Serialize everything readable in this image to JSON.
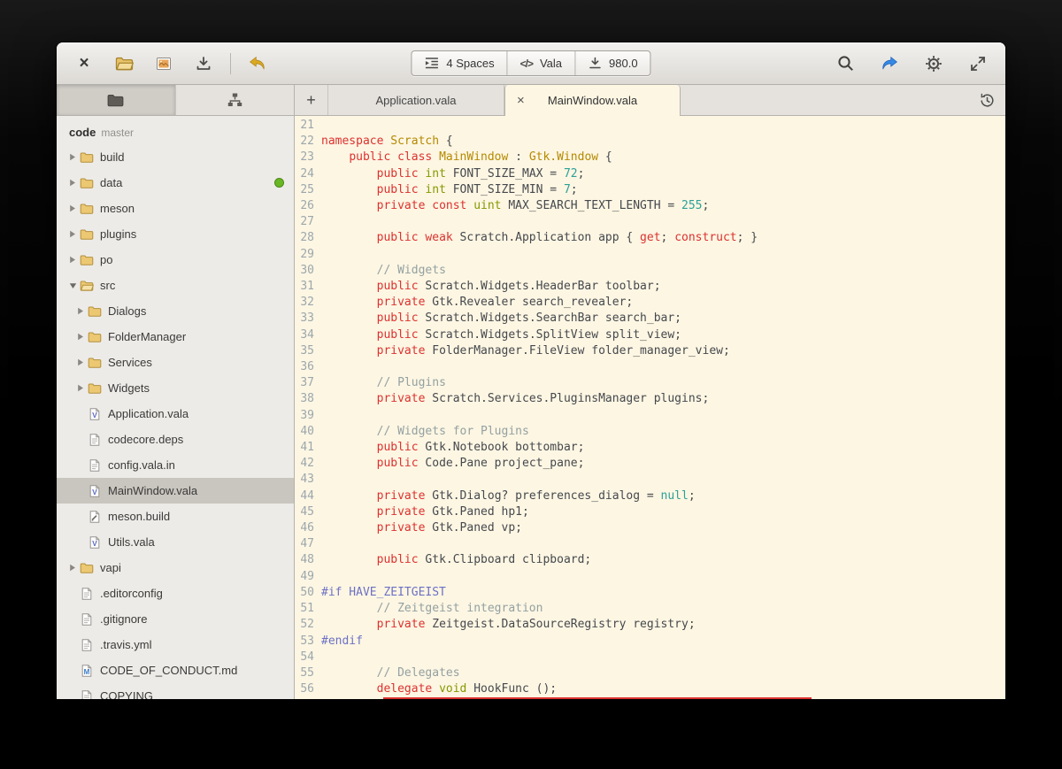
{
  "colors": {
    "green_dot": "#68b723",
    "accent_blue": "#3689e6",
    "undo_amber": "#dba821"
  },
  "headerbar": {
    "buttons_left": [
      {
        "name": "close-window",
        "icon": "close"
      },
      {
        "name": "open-file",
        "icon": "open-folder"
      },
      {
        "name": "templates",
        "icon": "templates"
      },
      {
        "name": "save",
        "icon": "save"
      },
      {
        "type": "separator"
      },
      {
        "name": "undo",
        "icon": "undo"
      }
    ],
    "buttons_center": [
      {
        "name": "indentation",
        "icon": "indent",
        "label": "4 Spaces"
      },
      {
        "name": "language",
        "icon": "code-tag",
        "label": "Vala"
      },
      {
        "name": "goto-line",
        "icon": "goto-line",
        "label": "980.0"
      }
    ],
    "buttons_right": [
      {
        "name": "search",
        "icon": "search"
      },
      {
        "name": "share",
        "icon": "share"
      },
      {
        "name": "settings",
        "icon": "gear"
      },
      {
        "name": "fullscreen",
        "icon": "expand"
      }
    ]
  },
  "sidebar": {
    "project_name": "code",
    "project_branch": "master",
    "panel_tabs": [
      {
        "name": "files-view",
        "icon": "files-folder",
        "active": true
      },
      {
        "name": "outline-view",
        "icon": "outline",
        "active": false
      }
    ],
    "items": [
      {
        "label": "build",
        "icon": "folder",
        "depth": 0,
        "arrow": "collapsed"
      },
      {
        "label": "data",
        "icon": "folder",
        "depth": 0,
        "arrow": "collapsed",
        "badge": "green-dot"
      },
      {
        "label": "meson",
        "icon": "folder",
        "depth": 0,
        "arrow": "collapsed"
      },
      {
        "label": "plugins",
        "icon": "folder",
        "depth": 0,
        "arrow": "collapsed"
      },
      {
        "label": "po",
        "icon": "folder",
        "depth": 0,
        "arrow": "collapsed"
      },
      {
        "label": "src",
        "icon": "folder-open",
        "depth": 0,
        "arrow": "expanded"
      },
      {
        "label": "Dialogs",
        "icon": "folder",
        "depth": 1,
        "arrow": "collapsed"
      },
      {
        "label": "FolderManager",
        "icon": "folder",
        "depth": 1,
        "arrow": "collapsed"
      },
      {
        "label": "Services",
        "icon": "folder",
        "depth": 1,
        "arrow": "collapsed"
      },
      {
        "label": "Widgets",
        "icon": "folder",
        "depth": 1,
        "arrow": "collapsed"
      },
      {
        "label": "Application.vala",
        "icon": "file-vala",
        "depth": 1
      },
      {
        "label": "codecore.deps",
        "icon": "file-text",
        "depth": 1
      },
      {
        "label": "config.vala.in",
        "icon": "file-text",
        "depth": 1
      },
      {
        "label": "MainWindow.vala",
        "icon": "file-vala",
        "depth": 1,
        "selected": true
      },
      {
        "label": "meson.build",
        "icon": "file-build",
        "depth": 1
      },
      {
        "label": "Utils.vala",
        "icon": "file-vala",
        "depth": 1
      },
      {
        "label": "vapi",
        "icon": "folder",
        "depth": 0,
        "arrow": "collapsed"
      },
      {
        "label": ".editorconfig",
        "icon": "file-text",
        "depth": 0
      },
      {
        "label": ".gitignore",
        "icon": "file-text",
        "depth": 0
      },
      {
        "label": ".travis.yml",
        "icon": "file-text",
        "depth": 0
      },
      {
        "label": "CODE_OF_CONDUCT.md",
        "icon": "file-md",
        "depth": 0
      },
      {
        "label": "COPYING",
        "icon": "file-text",
        "depth": 0
      }
    ]
  },
  "tabbar": {
    "new_tab_icon": "plus",
    "history_icon": "history",
    "tabs": [
      {
        "label": "Application.vala",
        "active": false
      },
      {
        "label": "MainWindow.vala",
        "active": true,
        "closable": true
      }
    ]
  },
  "editor": {
    "first_line": 21,
    "clipped_next_line_marker": true,
    "token_colors": {
      "keyword": "#dc322f",
      "class": "#b58900",
      "type": "#859900",
      "number": "#2aa198",
      "comment": "#93a1a1",
      "preprocessor": "#6c71c4",
      "plain": "#45484d",
      "line_number": "#9ca7ac",
      "background": "#fdf6e3"
    },
    "lines": [
      [],
      [
        [
          "k",
          "namespace"
        ],
        [
          "p",
          " "
        ],
        [
          "y",
          "Scratch"
        ],
        [
          "p",
          " {"
        ]
      ],
      [
        [
          "p",
          "    "
        ],
        [
          "k",
          "public class"
        ],
        [
          "p",
          " "
        ],
        [
          "y",
          "MainWindow"
        ],
        [
          "p",
          " : "
        ],
        [
          "y",
          "Gtk.Window"
        ],
        [
          "p",
          " {"
        ]
      ],
      [
        [
          "p",
          "        "
        ],
        [
          "k",
          "public"
        ],
        [
          "p",
          " "
        ],
        [
          "t",
          "int"
        ],
        [
          "p",
          " FONT_SIZE_MAX = "
        ],
        [
          "n",
          "72"
        ],
        [
          "p",
          ";"
        ]
      ],
      [
        [
          "p",
          "        "
        ],
        [
          "k",
          "public"
        ],
        [
          "p",
          " "
        ],
        [
          "t",
          "int"
        ],
        [
          "p",
          " FONT_SIZE_MIN = "
        ],
        [
          "n",
          "7"
        ],
        [
          "p",
          ";"
        ]
      ],
      [
        [
          "p",
          "        "
        ],
        [
          "k",
          "private const"
        ],
        [
          "p",
          " "
        ],
        [
          "t",
          "uint"
        ],
        [
          "p",
          " MAX_SEARCH_TEXT_LENGTH = "
        ],
        [
          "n",
          "255"
        ],
        [
          "p",
          ";"
        ]
      ],
      [],
      [
        [
          "p",
          "        "
        ],
        [
          "k",
          "public weak"
        ],
        [
          "p",
          " Scratch.Application app { "
        ],
        [
          "k",
          "get"
        ],
        [
          "p",
          "; "
        ],
        [
          "k",
          "construct"
        ],
        [
          "p",
          "; }"
        ]
      ],
      [],
      [
        [
          "p",
          "        "
        ],
        [
          "c",
          "// Widgets"
        ]
      ],
      [
        [
          "p",
          "        "
        ],
        [
          "k",
          "public"
        ],
        [
          "p",
          " Scratch.Widgets.HeaderBar toolbar;"
        ]
      ],
      [
        [
          "p",
          "        "
        ],
        [
          "k",
          "private"
        ],
        [
          "p",
          " Gtk.Revealer search_revealer;"
        ]
      ],
      [
        [
          "p",
          "        "
        ],
        [
          "k",
          "public"
        ],
        [
          "p",
          " Scratch.Widgets.SearchBar search_bar;"
        ]
      ],
      [
        [
          "p",
          "        "
        ],
        [
          "k",
          "public"
        ],
        [
          "p",
          " Scratch.Widgets.SplitView split_view;"
        ]
      ],
      [
        [
          "p",
          "        "
        ],
        [
          "k",
          "private"
        ],
        [
          "p",
          " FolderManager.FileView folder_manager_view;"
        ]
      ],
      [],
      [
        [
          "p",
          "        "
        ],
        [
          "c",
          "// Plugins"
        ]
      ],
      [
        [
          "p",
          "        "
        ],
        [
          "k",
          "private"
        ],
        [
          "p",
          " Scratch.Services.PluginsManager plugins;"
        ]
      ],
      [],
      [
        [
          "p",
          "        "
        ],
        [
          "c",
          "// Widgets for Plugins"
        ]
      ],
      [
        [
          "p",
          "        "
        ],
        [
          "k",
          "public"
        ],
        [
          "p",
          " Gtk.Notebook bottombar;"
        ]
      ],
      [
        [
          "p",
          "        "
        ],
        [
          "k",
          "public"
        ],
        [
          "p",
          " Code.Pane project_pane;"
        ]
      ],
      [],
      [
        [
          "p",
          "        "
        ],
        [
          "k",
          "private"
        ],
        [
          "p",
          " Gtk.Dialog? preferences_dialog = "
        ],
        [
          "n",
          "null"
        ],
        [
          "p",
          ";"
        ]
      ],
      [
        [
          "p",
          "        "
        ],
        [
          "k",
          "private"
        ],
        [
          "p",
          " Gtk.Paned hp1;"
        ]
      ],
      [
        [
          "p",
          "        "
        ],
        [
          "k",
          "private"
        ],
        [
          "p",
          " Gtk.Paned vp;"
        ]
      ],
      [],
      [
        [
          "p",
          "        "
        ],
        [
          "k",
          "public"
        ],
        [
          "p",
          " Gtk.Clipboard clipboard;"
        ]
      ],
      [],
      [
        [
          "d",
          "#if HAVE_ZEITGEIST"
        ]
      ],
      [
        [
          "p",
          "        "
        ],
        [
          "c",
          "// Zeitgeist integration"
        ]
      ],
      [
        [
          "p",
          "        "
        ],
        [
          "k",
          "private"
        ],
        [
          "p",
          " Zeitgeist.DataSourceRegistry registry;"
        ]
      ],
      [
        [
          "d",
          "#endif"
        ]
      ],
      [],
      [
        [
          "p",
          "        "
        ],
        [
          "c",
          "// Delegates"
        ]
      ],
      [
        [
          "p",
          "        "
        ],
        [
          "k",
          "delegate"
        ],
        [
          "p",
          " "
        ],
        [
          "t",
          "void"
        ],
        [
          "p",
          " HookFunc ();"
        ]
      ]
    ]
  }
}
